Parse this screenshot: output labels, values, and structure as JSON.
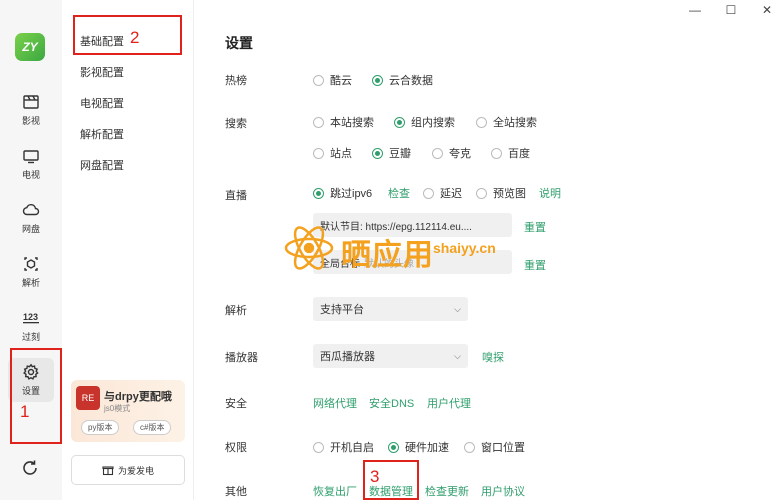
{
  "window": {
    "minimize": "—",
    "maximize": "☐",
    "close": "✕"
  },
  "logo": {
    "text": "ZY"
  },
  "rail": {
    "items": [
      {
        "id": "movies",
        "label": "影视",
        "icon": "clapperboard-icon"
      },
      {
        "id": "tv",
        "label": "电视",
        "icon": "tv-icon"
      },
      {
        "id": "cloud",
        "label": "网盘",
        "icon": "cloud-icon"
      },
      {
        "id": "parse",
        "label": "解析",
        "icon": "parse-icon"
      },
      {
        "id": "expire",
        "label": "过刻",
        "icon": "counter-icon"
      },
      {
        "id": "settings",
        "label": "设置",
        "icon": "gear-icon",
        "active": true
      }
    ]
  },
  "submenu": {
    "items": [
      "基础配置",
      "影视配置",
      "电视配置",
      "解析配置",
      "网盘配置"
    ],
    "promo": {
      "icon_text": "RE",
      "title": "与drpy更配哦",
      "subtitle": "js0模式",
      "tag1": "py版本",
      "tag2": "c#版本"
    },
    "donate": "为爱发电"
  },
  "main": {
    "title": "设置",
    "hot": {
      "label": "热榜",
      "opt1": "酷云",
      "opt2": "云合数据"
    },
    "search": {
      "label": "搜索",
      "row1": [
        "本站搜索",
        "组内搜索",
        "全站搜索"
      ],
      "row2": [
        "站点",
        "豆瓣",
        "夸克",
        "百度"
      ]
    },
    "live": {
      "label": "直播",
      "skip_ipv6": "跳过ipv6",
      "check": "检查",
      "delay": "延迟",
      "preview": "预览图",
      "explain": "说明",
      "epg_value": "默认节目: https://epg.112114.eu....",
      "reset1": "重置",
      "logo_label": "全局台标",
      "logo_placeholder": "默认的头像",
      "reset2": "重置"
    },
    "parse": {
      "label": "解析",
      "value": "支持平台"
    },
    "player": {
      "label": "播放器",
      "value": "西瓜播放器",
      "sniff": "嗅探"
    },
    "security": {
      "label": "安全",
      "links": [
        "网络代理",
        "安全DNS",
        "用户代理"
      ]
    },
    "permission": {
      "label": "权限",
      "opts": [
        "开机自启",
        "硬件加速",
        "窗口位置"
      ]
    },
    "other": {
      "label": "其他",
      "links": [
        "恢复出厂",
        "数据管理",
        "检查更新",
        "用户协议"
      ]
    }
  },
  "annotations": {
    "n1": "1",
    "n2": "2",
    "n3": "3"
  },
  "watermark": {
    "text": "晒应用",
    "domain": "shaiyy.cn"
  },
  "colors": {
    "accent": "#2f9e6c",
    "annotation": "#e0221c",
    "watermark": "#f3a11e"
  }
}
